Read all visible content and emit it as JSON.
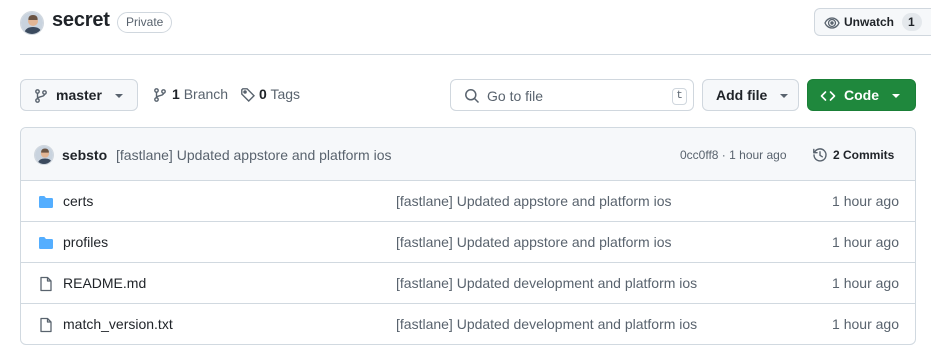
{
  "repo": {
    "name": "secret",
    "visibility": "Private",
    "watch_label": "Unwatch",
    "watch_count": "1"
  },
  "toolbar": {
    "branch_name": "master",
    "branches_count": "1",
    "branches_label": "Branch",
    "tags_count": "0",
    "tags_label": "Tags",
    "search_placeholder": "Go to file",
    "search_shortcut": "t",
    "add_file_label": "Add file",
    "code_label": "Code"
  },
  "latest_commit": {
    "author": "sebsto",
    "message": "[fastlane] Updated appstore and platform ios",
    "meta": "0cc0ff8 · 1 hour ago",
    "commits_label": "2 Commits"
  },
  "files": [
    {
      "name": "certs",
      "type": "folder",
      "icon": "folder-icon",
      "message": "[fastlane] Updated appstore and platform ios",
      "age": "1 hour ago"
    },
    {
      "name": "profiles",
      "type": "folder",
      "icon": "folder-icon",
      "message": "[fastlane] Updated appstore and platform ios",
      "age": "1 hour ago"
    },
    {
      "name": "README.md",
      "type": "file",
      "icon": "file-icon",
      "message": "[fastlane] Updated development and platform ios",
      "age": "1 hour ago"
    },
    {
      "name": "match_version.txt",
      "type": "file",
      "icon": "file-icon",
      "message": "[fastlane] Updated development and platform ios",
      "age": "1 hour ago"
    }
  ],
  "colors": {
    "primary_green": "#1f883d",
    "folder_blue": "#54aeff",
    "muted_text": "#59636e",
    "border": "#d1d9e0"
  }
}
